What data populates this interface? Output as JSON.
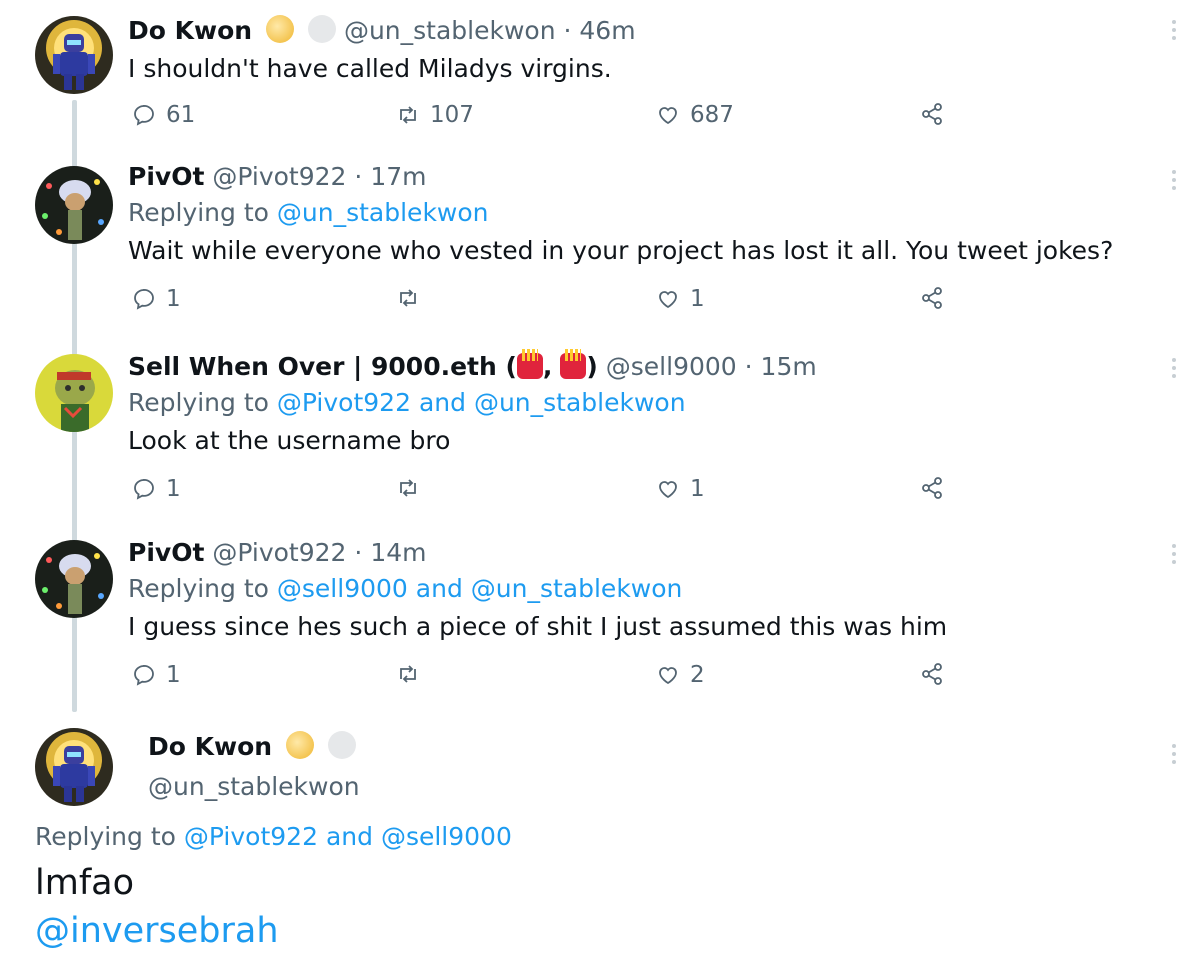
{
  "tweets": [
    {
      "name": "Do Kwon",
      "handle": "@un_stablekwon",
      "sep": "·",
      "time": "46m",
      "replying_prefix": "",
      "text": "I shouldn't have called Miladys virgins.",
      "replies": "61",
      "retweets": "107",
      "likes": "687"
    },
    {
      "name": "PivOt",
      "handle": "@Pivot922",
      "sep": "·",
      "time": "17m",
      "replying_prefix": "Replying to",
      "replying_to": [
        "@un_stablekwon"
      ],
      "text": "Wait while everyone who vested in your project has lost it all. You tweet jokes?",
      "replies": "1",
      "retweets": "",
      "likes": "1"
    },
    {
      "name": "Sell When Over | 9000.eth (",
      "name_mid": ",",
      "name_end": ")",
      "handle": "@sell9000",
      "sep": "·",
      "time": "15m",
      "replying_prefix": "Replying to",
      "replying_to": [
        "@Pivot922",
        "@un_stablekwon"
      ],
      "and": "and",
      "text": "Look at the username bro",
      "replies": "1",
      "retweets": "",
      "likes": "1"
    },
    {
      "name": "PivOt",
      "handle": "@Pivot922",
      "sep": "·",
      "time": "14m",
      "replying_prefix": "Replying to",
      "replying_to": [
        "@sell9000",
        "@un_stablekwon"
      ],
      "and": "and",
      "text": "I guess since hes such a piece of shit I just assumed this was him",
      "replies": "1",
      "retweets": "",
      "likes": "2"
    }
  ],
  "main_tweet": {
    "name": "Do Kwon",
    "handle": "@un_stablekwon",
    "replying_prefix": "Replying to",
    "replying_to": [
      "@Pivot922",
      "@sell9000"
    ],
    "and": "and",
    "text": "lmfao",
    "link": "@inversebrah"
  },
  "icons": {
    "reply": "reply-icon",
    "retweet": "retweet-icon",
    "like": "heart-icon",
    "share": "share-icon",
    "more": "more-icon"
  },
  "colors": {
    "link": "#1d9bf0",
    "muted": "#536471",
    "thread_line": "#cfd9de"
  }
}
